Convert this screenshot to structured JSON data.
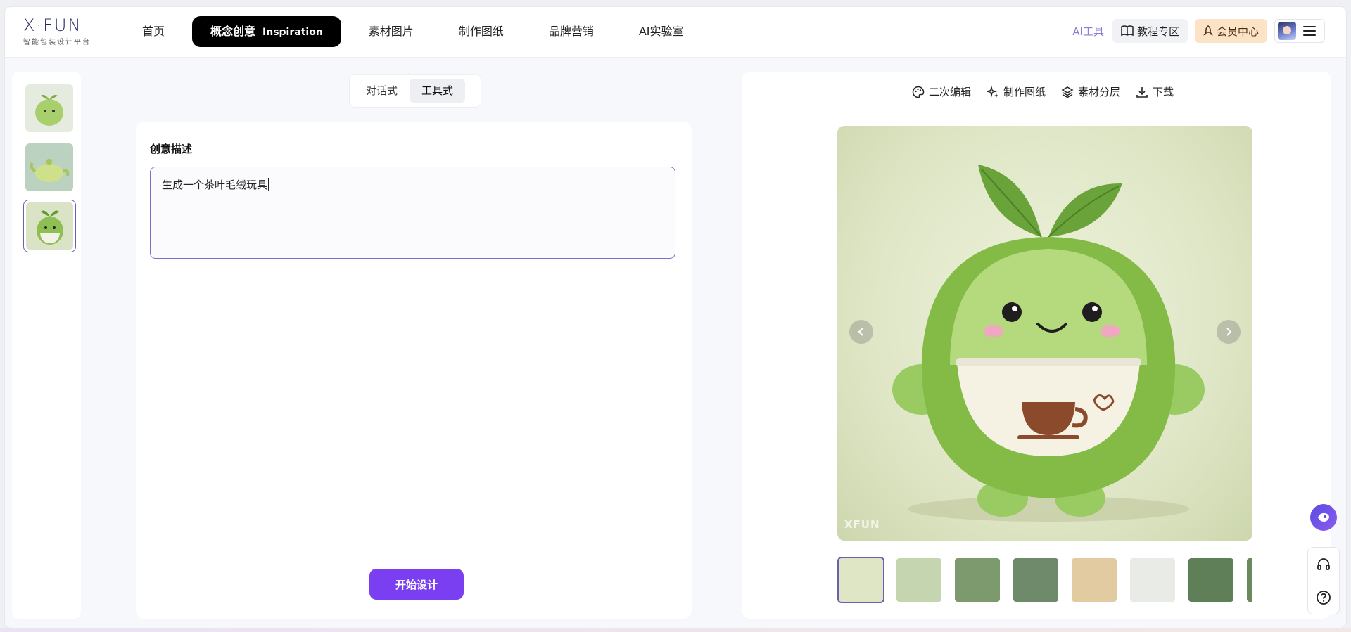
{
  "brand": {
    "logo": "X·FUN",
    "tagline": "智能包装设计平台"
  },
  "nav": {
    "items": [
      {
        "label": "首页"
      },
      {
        "label": "概念创意",
        "en": "Inspiration",
        "active": true
      },
      {
        "label": "素材图片"
      },
      {
        "label": "制作图纸"
      },
      {
        "label": "品牌营销"
      },
      {
        "label": "AI实验室"
      }
    ]
  },
  "header_right": {
    "ai_tools": "AI工具",
    "tutorial": "教程专区",
    "vip": "会员中心"
  },
  "mode_tabs": {
    "chat": "对话式",
    "tool": "工具式",
    "active": "tool"
  },
  "form": {
    "label": "创意描述",
    "value": "生成一个茶叶毛绒玩具",
    "submit": "开始设计"
  },
  "toolbar": {
    "edit": "二次编辑",
    "draw": "制作图纸",
    "layer": "素材分层",
    "download": "下载"
  },
  "preview": {
    "watermark": "XFUN"
  },
  "colors": {
    "accent": "#7b3ff2",
    "selection": "#6b5fb0",
    "vip_bg": "#fde3c6"
  }
}
